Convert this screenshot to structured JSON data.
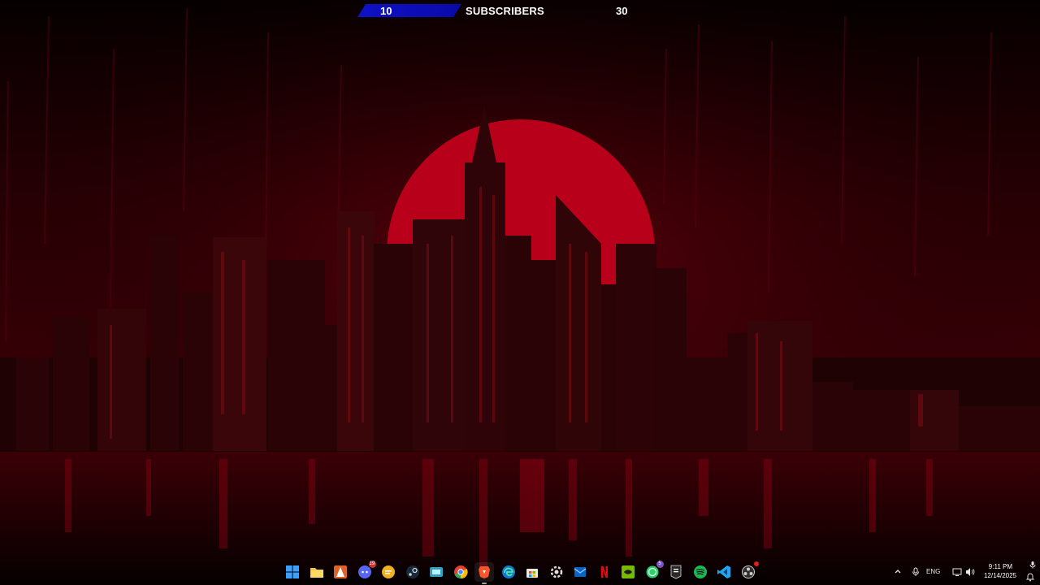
{
  "widget": {
    "current": "10",
    "label": "SUBSCRIBERS",
    "goal": "30",
    "bar_color": "#1010c8"
  },
  "wallpaper": {
    "theme": "red city skyline with sun and rain",
    "accent": "#c0001a"
  },
  "taskbar": {
    "apps": [
      {
        "icon": "windows-start-icon",
        "interactable": true
      },
      {
        "icon": "file-explorer-icon"
      },
      {
        "icon": "affinity-icon"
      },
      {
        "icon": "discord-icon",
        "badge": "19"
      },
      {
        "icon": "chat-bubble-icon"
      },
      {
        "icon": "steam-icon"
      },
      {
        "icon": "game-launcher-icon"
      },
      {
        "icon": "chrome-icon"
      },
      {
        "icon": "brave-icon",
        "active": true
      },
      {
        "icon": "edge-icon"
      },
      {
        "icon": "microsoft-store-icon"
      },
      {
        "icon": "settings-gear-icon"
      },
      {
        "icon": "outlook-icon"
      },
      {
        "icon": "netflix-icon"
      },
      {
        "icon": "nvidia-icon"
      },
      {
        "icon": "whatsapp-icon",
        "badge": "5"
      },
      {
        "icon": "epic-games-icon"
      },
      {
        "icon": "spotify-icon"
      },
      {
        "icon": "vscode-icon"
      },
      {
        "icon": "obs-icon"
      }
    ],
    "tray": {
      "language": "ENG",
      "time": "9:11 PM",
      "date": "12/14/2025"
    }
  }
}
